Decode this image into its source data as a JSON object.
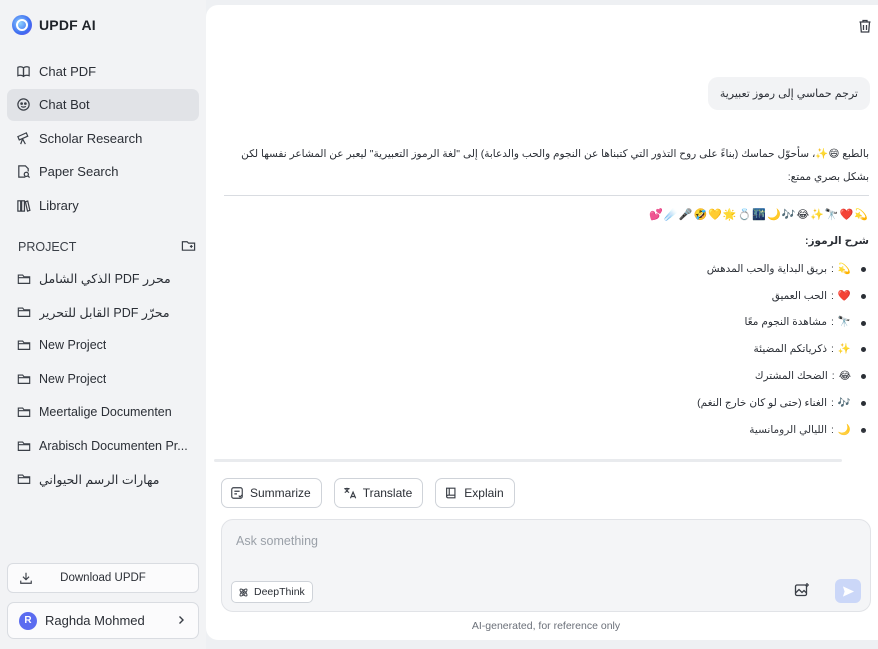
{
  "app": {
    "name": "UPDF AI"
  },
  "nav": [
    {
      "label": "Chat PDF",
      "icon": "book-open-icon",
      "active": false
    },
    {
      "label": "Chat Bot",
      "icon": "robot-icon",
      "active": true
    },
    {
      "label": "Scholar Research",
      "icon": "telescope-icon",
      "active": false
    },
    {
      "label": "Paper Search",
      "icon": "document-search-icon",
      "active": false
    },
    {
      "label": "Library",
      "icon": "library-icon",
      "active": false
    }
  ],
  "project": {
    "title": "PROJECT",
    "items": [
      "الذكي الشامل PDF محرر",
      "القابل للتحرير PDF محرّر",
      "New Project",
      "New Project",
      "Meertalige Documenten",
      "Arabisch Documenten Pr...",
      "مهارات الرسم الحيواني"
    ]
  },
  "download_label": "Download UPDF",
  "user": {
    "initial": "R",
    "name": "Raghda Mohmed"
  },
  "chat": {
    "user_message": "ترجم حماسي إلى رموز تعبيرية",
    "answer_intro": "بالطبع 😄✨، سأحوّل حماسك (بناءً على روح التذور التي كتبناها عن النجوم والحب والدعابة) إلى \"لغة الرموز التعبيرية\" ليعبر عن المشاعر نفسها لكن بشكل بصري ممتع:",
    "emoji_line": "💫❤️🔭✨😂🎶🌙🌃💍🌟💛🤣🎤☄️💕",
    "legend_title": "شرح الرموز:",
    "legend": [
      {
        "emoji": "💫",
        "text": "بريق البداية والحب المدهش"
      },
      {
        "emoji": "❤️",
        "text": "الحب العميق"
      },
      {
        "emoji": "🔭",
        "text": "مشاهدة النجوم معًا"
      },
      {
        "emoji": "✨",
        "text": "ذكرياتكم المضيئة"
      },
      {
        "emoji": "😂",
        "text": "الضحك المشترك"
      },
      {
        "emoji": "🎶",
        "text": "الغناء (حتى لو كان خارج النغم)"
      },
      {
        "emoji": "🌙",
        "text": "الليالي الرومانسية"
      }
    ]
  },
  "actions": [
    {
      "label": "Summarize",
      "icon": "summarize-icon"
    },
    {
      "label": "Translate",
      "icon": "translate-icon"
    },
    {
      "label": "Explain",
      "icon": "book-icon"
    }
  ],
  "composer": {
    "placeholder": "Ask something",
    "deepthink_label": "DeepThink"
  },
  "footer_note": "AI-generated, for reference only"
}
